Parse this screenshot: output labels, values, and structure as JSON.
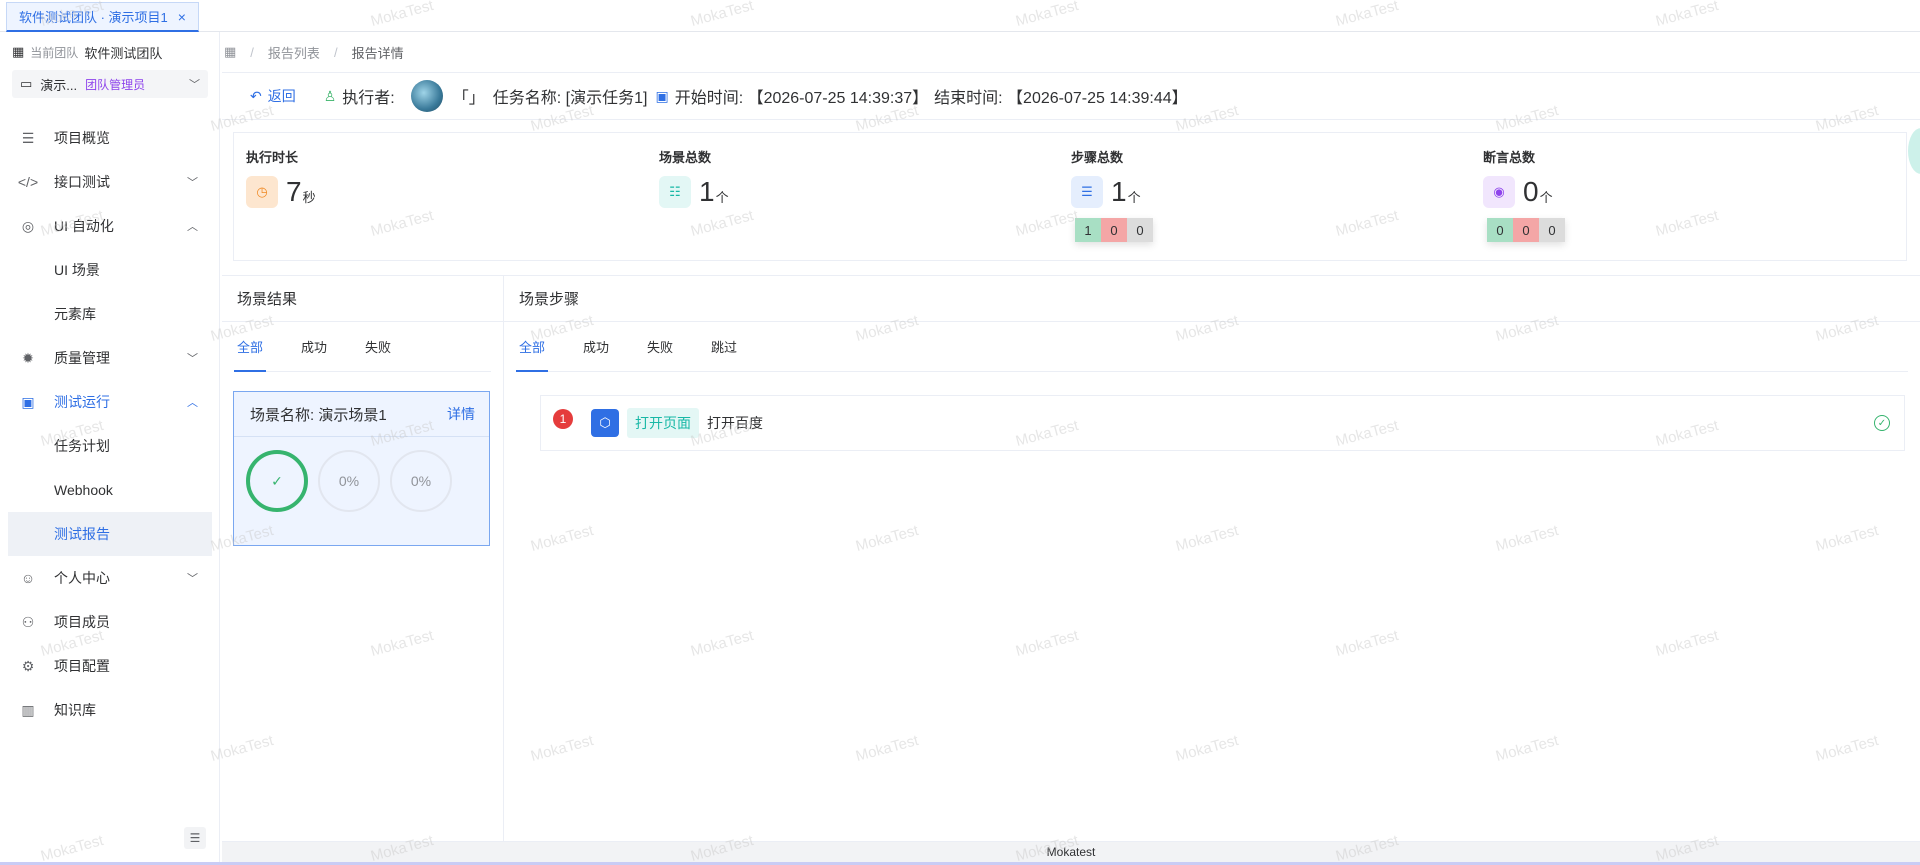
{
  "tab": {
    "label": "软件测试团队 · 演示项目1",
    "close": "×"
  },
  "sidebar": {
    "team_label": "当前团队",
    "team_name": "软件测试团队",
    "project_short": "演示...",
    "project_role": "团队管理员",
    "items": [
      {
        "label": "项目概览"
      },
      {
        "label": "接口测试"
      },
      {
        "label": "UI 自动化"
      },
      {
        "label": "UI 场景"
      },
      {
        "label": "元素库"
      },
      {
        "label": "质量管理"
      },
      {
        "label": "测试运行"
      },
      {
        "label": "任务计划"
      },
      {
        "label": "Webhook"
      },
      {
        "label": "测试报告"
      },
      {
        "label": "个人中心"
      },
      {
        "label": "项目成员"
      },
      {
        "label": "项目配置"
      },
      {
        "label": "知识库"
      }
    ]
  },
  "breadcrumb": {
    "list": "报告列表",
    "detail": "报告详情"
  },
  "header": {
    "back": "返回",
    "executor_label": "执行者:",
    "executor_name": "「」",
    "task_label": "任务名称: [演示任务1]",
    "start": "开始时间: 【2026-07-25 14:39:37】",
    "end": "结束时间: 【2026-07-25 14:39:44】"
  },
  "stats": {
    "duration": {
      "label": "执行时长",
      "value": "7",
      "unit": "秒"
    },
    "scenes": {
      "label": "场景总数",
      "value": "1",
      "unit": "个"
    },
    "steps": {
      "label": "步骤总数",
      "value": "1",
      "unit": "个",
      "pass": "1",
      "fail": "0",
      "skip": "0"
    },
    "asserts": {
      "label": "断言总数",
      "value": "0",
      "unit": "个",
      "pass": "0",
      "fail": "0",
      "skip": "0"
    }
  },
  "scene_results": {
    "title": "场景结果",
    "tabs": [
      "全部",
      "成功",
      "失败"
    ],
    "card": {
      "name": "场景名称: 演示场景1",
      "detail": "详情",
      "ring2": "0%",
      "ring3": "0%"
    }
  },
  "scene_steps": {
    "title": "场景步骤",
    "tabs": [
      "全部",
      "成功",
      "失败",
      "跳过"
    ],
    "step": {
      "index": "1",
      "tag": "打开页面",
      "name": "打开百度"
    }
  },
  "footer": "Mokatest",
  "watermark": "MokaTest",
  "colors": {
    "primary": "#2f6fe4",
    "success": "#36b46e",
    "danger": "#e53c3c",
    "role": "#8e44ec"
  }
}
